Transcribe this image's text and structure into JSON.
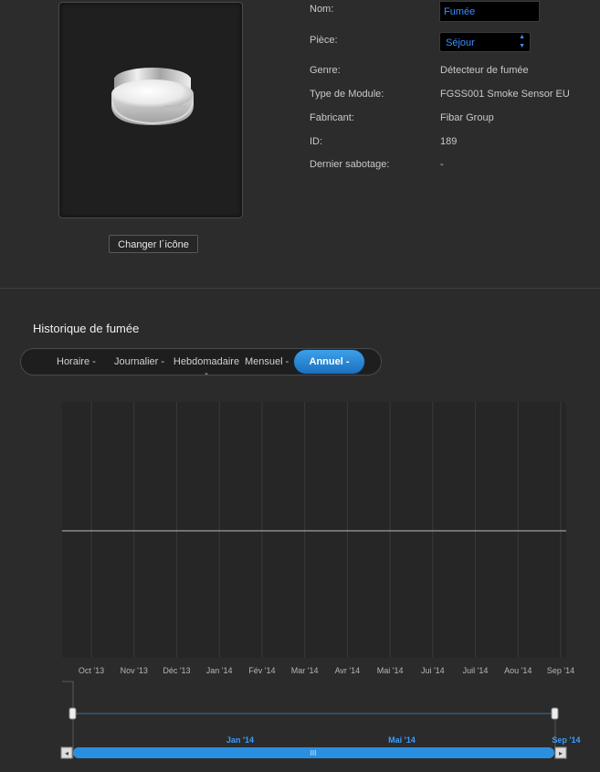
{
  "device": {
    "change_icon_label": "Changer l´icône",
    "properties": [
      {
        "label": "Nom:",
        "value": "Fumée"
      },
      {
        "label": "Pièce:",
        "value": "Séjour"
      },
      {
        "label": "Genre:",
        "value": "Détecteur de fumée"
      },
      {
        "label": "Type de Module:",
        "value": "FGSS001 Smoke Sensor EU"
      },
      {
        "label": "Fabricant:",
        "value": "Fibar Group"
      },
      {
        "label": "ID:",
        "value": "189"
      },
      {
        "label": "Dernier sabotage:",
        "value": "-"
      }
    ]
  },
  "history": {
    "title": "Historique de fumée",
    "tabs": [
      "Horaire -",
      "Journalier -",
      "Hebdomadaire -",
      "Mensuel -",
      "Annuel -"
    ],
    "active_tab": "Annuel -"
  },
  "colors": {
    "accent": "#2b8fe0",
    "label_blue": "#3b9cff",
    "grid": "#3a3a3a",
    "line": "#8a8a8a"
  },
  "chart_data": {
    "type": "line",
    "categories": [
      "Oct '13",
      "Nov '13",
      "Déc '13",
      "Jan '14",
      "Fév '14",
      "Mar '14",
      "Avr '14",
      "Mai '14",
      "Jui '14",
      "Juil '14",
      "Aou '14",
      "Sep '14"
    ],
    "series": [
      {
        "values": [
          0,
          0,
          0,
          0,
          0,
          0,
          0,
          0,
          0,
          0,
          0,
          0
        ]
      }
    ],
    "navigator_labels": [
      "Jan '14",
      "Mai '14",
      "Sep '14"
    ]
  }
}
